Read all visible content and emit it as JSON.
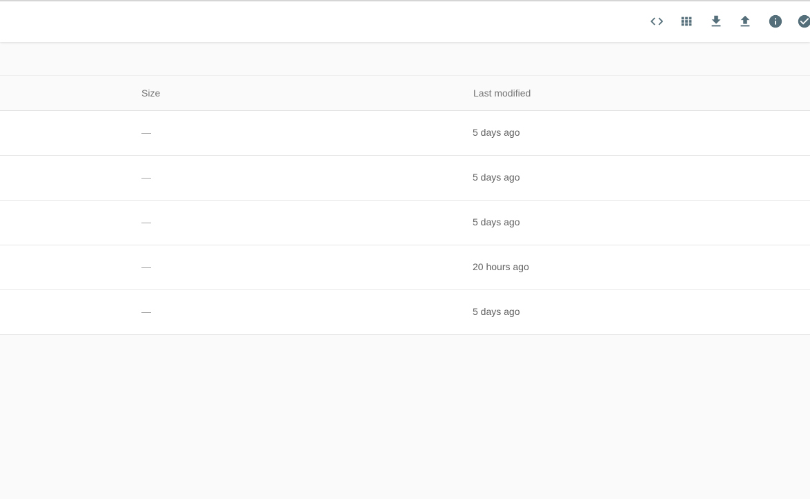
{
  "toolbar": {
    "icons": [
      "code-icon",
      "grid-view-icon",
      "download-icon",
      "upload-icon",
      "info-icon",
      "check-circle-icon"
    ]
  },
  "table": {
    "columns": {
      "size": "Size",
      "last_modified": "Last modified"
    },
    "rows": [
      {
        "size": "—",
        "last_modified": "5 days ago"
      },
      {
        "size": "—",
        "last_modified": "5 days ago"
      },
      {
        "size": "—",
        "last_modified": "5 days ago"
      },
      {
        "size": "—",
        "last_modified": "20 hours ago"
      },
      {
        "size": "—",
        "last_modified": "5 days ago"
      }
    ]
  },
  "colors": {
    "icon": "#546e7a",
    "background": "#fafafa",
    "row_background": "#ffffff"
  }
}
